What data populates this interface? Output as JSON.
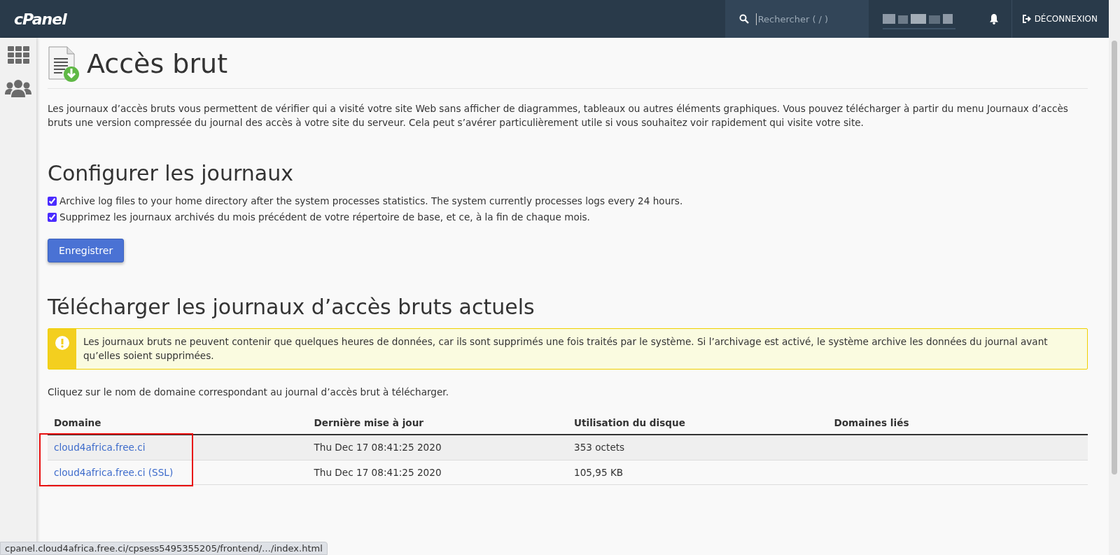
{
  "header": {
    "logo": "cPanel",
    "search": {
      "placeholder": "Rechercher ( / )"
    },
    "logout": "DÉCONNEXION"
  },
  "page": {
    "title": "Accès brut",
    "intro": "Les journaux d’accès bruts vous permettent de vérifier qui a visité votre site Web sans afficher de diagrammes, tableaux ou autres éléments graphiques. Vous pouvez télécharger à partir du menu Journaux d’accès bruts une version compressée du journal des accès à votre site du serveur. Cela peut s’avérer particulièrement utile si vous souhaitez voir rapidement qui visite votre site."
  },
  "configure": {
    "heading": "Configurer les journaux",
    "options": [
      {
        "label": "Archive log files to your home directory after the system processes statistics. The system currently processes logs every 24 hours.",
        "checked": true
      },
      {
        "label": "Supprimez les journaux archivés du mois précédent de votre répertoire de base, et ce, à la fin de chaque mois.",
        "checked": true
      }
    ],
    "save_button": "Enregistrer"
  },
  "download": {
    "heading": "Télécharger les journaux d’accès bruts actuels",
    "warning": "Les journaux bruts ne peuvent contenir que quelques heures de données, car ils sont supprimés une fois traités par le système. Si l’archivage est activé, le système archive les données du journal avant qu’elles soient supprimées.",
    "instruction": "Cliquez sur le nom de domaine correspondant au journal d’accès brut à télécharger.",
    "table": {
      "columns": [
        "Domaine",
        "Dernière mise à jour",
        "Utilisation du disque",
        "Domaines liés"
      ],
      "rows": [
        [
          "cloud4africa.free.ci",
          "Thu Dec 17 08:41:25 2020",
          "353 octets"
        ],
        [
          "cloud4africa.free.ci (SSL)",
          "Thu Dec 17 08:41:25 2020",
          "105,95 KB"
        ]
      ]
    }
  },
  "status_bar": "cpanel.cloud4africa.free.ci/cpsess5495355205/frontend/…/index.html"
}
